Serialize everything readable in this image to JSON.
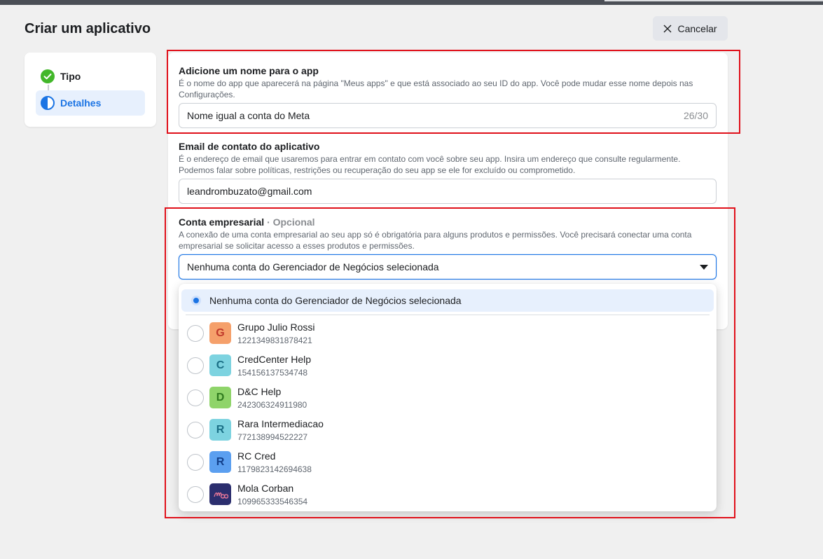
{
  "page": {
    "title": "Criar um aplicativo",
    "cancel_label": "Cancelar"
  },
  "steps": [
    {
      "label": "Tipo",
      "state": "complete"
    },
    {
      "label": "Detalhes",
      "state": "in-progress"
    }
  ],
  "form": {
    "app_name": {
      "title": "Adicione um nome para o app",
      "description": "É o nome do app que aparecerá na página \"Meus apps\" e que está associado ao seu ID do app. Você pode mudar esse nome depois nas Configurações.",
      "value": "Nome igual a conta do Meta",
      "char_count": "26/30"
    },
    "contact_email": {
      "title": "Email de contato do aplicativo",
      "description": "É o endereço de email que usaremos para entrar em contato com você sobre seu app. Insira um endereço que consulte regularmente. Podemos falar sobre políticas, restrições ou recuperação do seu app se ele for excluído ou comprometido.",
      "value": "leandrombuzato@gmail.com"
    },
    "business_account": {
      "title": "Conta empresarial",
      "optional": "· Opcional",
      "description": "A conexão de uma conta empresarial ao seu app só é obrigatória para alguns produtos e permissões. Você precisará conectar uma conta empresarial se solicitar acesso a esses produtos e permissões.",
      "selected": "Nenhuma conta do Gerenciador de Negócios selecionada"
    }
  },
  "dropdown": {
    "selected_option": "Nenhuma conta do Gerenciador de Negócios selecionada",
    "items": [
      {
        "name": "Grupo Julio Rossi",
        "id": "1221349831878421",
        "initial": "G",
        "bg": "#f5a06b",
        "fg": "#c0392b"
      },
      {
        "name": "CredCenter Help",
        "id": "154156137534748",
        "initial": "C",
        "bg": "#7dd3e0",
        "fg": "#1a6f86"
      },
      {
        "name": "D&C Help",
        "id": "242306324911980",
        "initial": "D",
        "bg": "#8fd46a",
        "fg": "#2f7a1e"
      },
      {
        "name": "Rara Intermediacao",
        "id": "772138994522227",
        "initial": "R",
        "bg": "#7dd3e0",
        "fg": "#1a6f86"
      },
      {
        "name": "RC Cred",
        "id": "1179823142694638",
        "initial": "R",
        "bg": "#5b9ff0",
        "fg": "#123f8a"
      },
      {
        "name": "Mola Corban",
        "id": "109965333546354",
        "initial": "",
        "bg": "#2b2e6e",
        "fg": "#f07a9a"
      }
    ]
  },
  "colors": {
    "accent": "#1b74e4",
    "highlight_border": "#e0101a",
    "success": "#42b72a"
  }
}
